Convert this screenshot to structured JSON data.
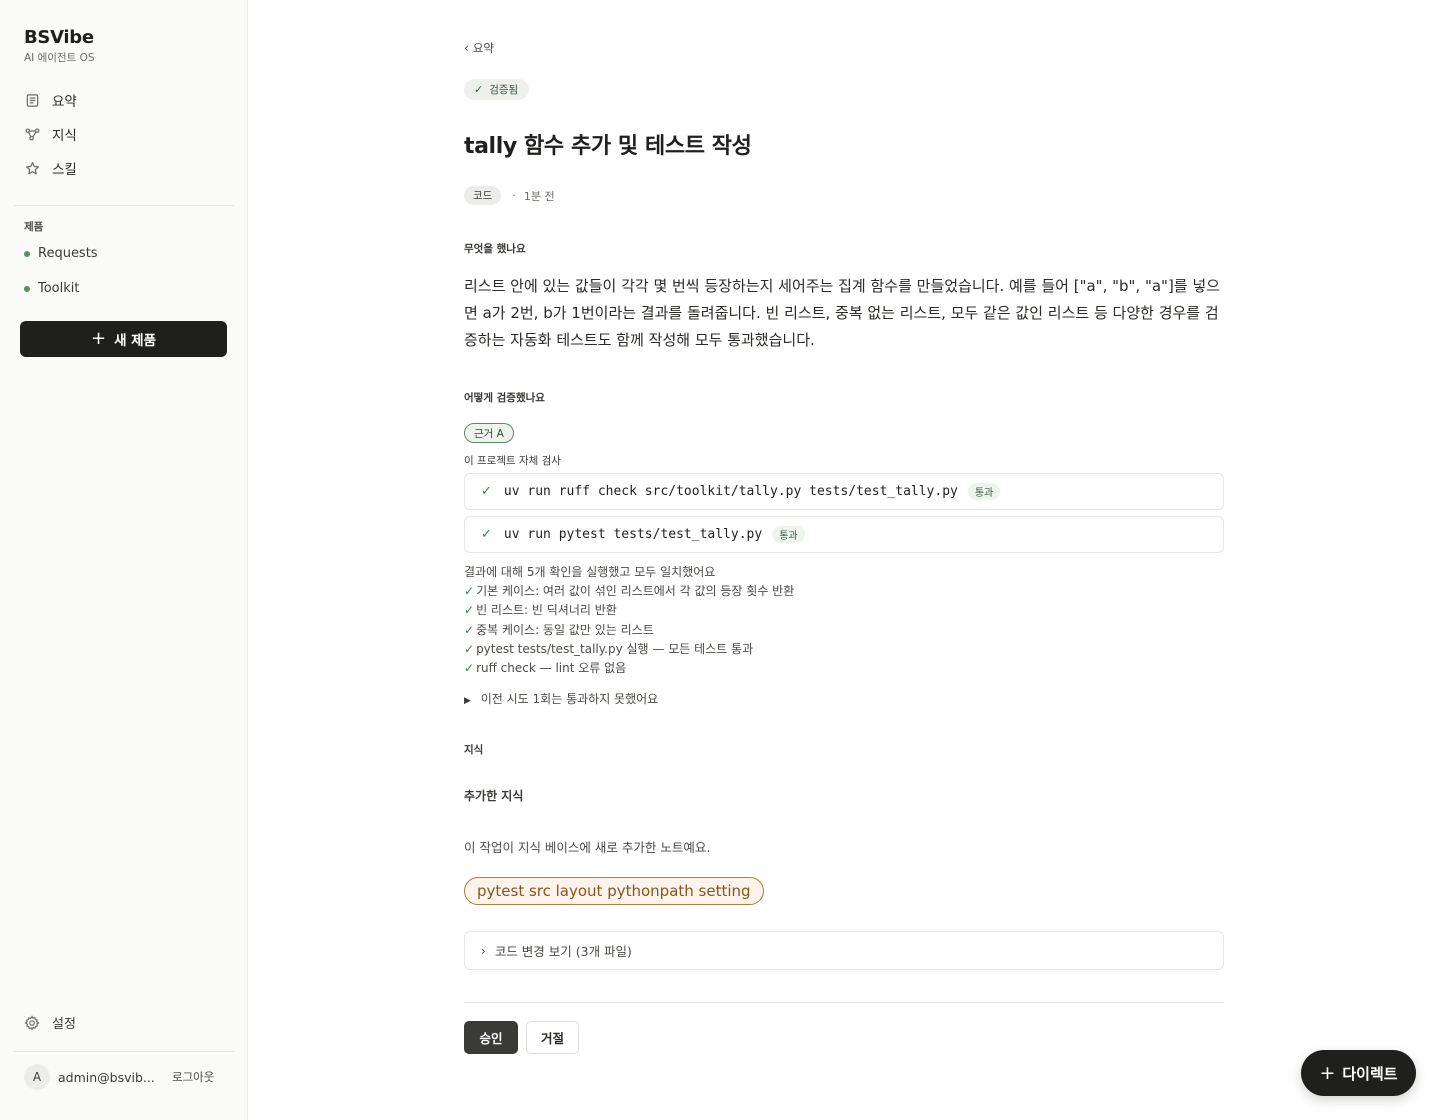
{
  "sidebar": {
    "brand_name": "BSVibe",
    "brand_sub": "AI 에이전트 OS",
    "nav": [
      {
        "label": "요약",
        "icon": "document-icon"
      },
      {
        "label": "지식",
        "icon": "graph-icon"
      },
      {
        "label": "스킬",
        "icon": "star-icon"
      }
    ],
    "section_label": "제품",
    "products": [
      {
        "label": "Requests"
      },
      {
        "label": "Toolkit"
      }
    ],
    "new_product_label": "새 제품",
    "settings_label": "설정",
    "user": {
      "avatar_initial": "A",
      "email": "admin@bsvib...",
      "logout_label": "로그아웃"
    }
  },
  "main": {
    "back_label": "요약",
    "status_badge": "검증됨",
    "title": "tally 함수 추가 및 테스트 작성",
    "tag": "코드",
    "time": "1분 전",
    "what_label": "무엇을 했나요",
    "summary": "리스트 안에 있는 값들이 각각 몇 번씩 등장하는지 세어주는 집계 함수를 만들었습니다. 예를 들어 [\"a\", \"b\", \"a\"]를 넣으면 a가 2번, b가 1번이라는 결과를 돌려줍니다. 빈 리스트, 중복 없는 리스트, 모두 같은 값인 리스트 등 다양한 경우를 검증하는 자동화 테스트도 함께 작성해 모두 통과했습니다.",
    "how_label": "어떻게 검증했나요",
    "evidence_badge": "근거 A",
    "self_check_label": "이 프로젝트 자체 검사",
    "commands": [
      {
        "code": "uv run ruff check src/toolkit/tally.py tests/test_tally.py",
        "status": "통과"
      },
      {
        "code": "uv run pytest tests/test_tally.py",
        "status": "통과"
      }
    ],
    "checks_header": "결과에 대해 5개 확인을 실행했고 모두 일치했어요",
    "checks": [
      "기본 케이스: 여러 값이 섞인 리스트에서 각 값의 등장 횟수 반환",
      "빈 리스트: 빈 딕셔너리 반환",
      "중복 케이스: 동일 값만 있는 리스트",
      "pytest tests/test_tally.py 실행 — 모든 테스트 통과",
      "ruff check — lint 오류 없음"
    ],
    "check_mark": "✓",
    "previous_attempts": "이전 시도 1회는 통과하지 못했어요",
    "knowledge_label": "지식",
    "knowledge_added_label": "추가한 지식",
    "knowledge_desc": "이 작업이 지식 베이스에 새로 추가한 노트예요.",
    "knowledge_note": "pytest src layout pythonpath setting",
    "diff_label": "코드 변경 보기 (3개 파일)",
    "approve_label": "승인",
    "reject_label": "거절"
  },
  "fab_label": "다이렉트"
}
